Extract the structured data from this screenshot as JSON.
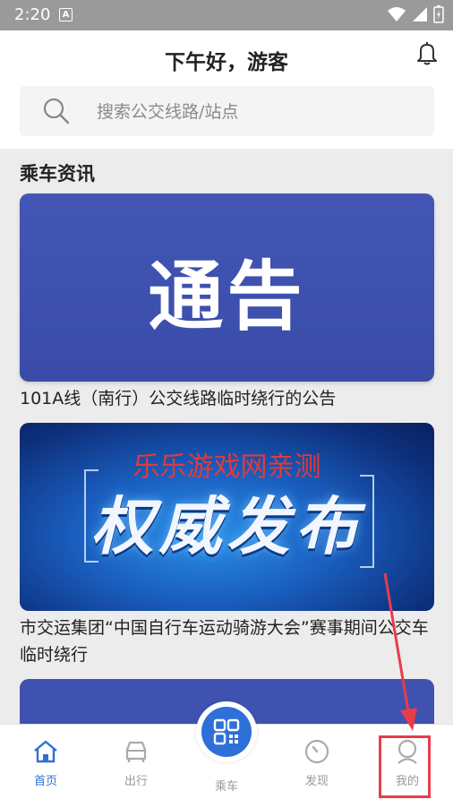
{
  "status_bar": {
    "time": "2:20",
    "badge": "A"
  },
  "header": {
    "greeting": "下午好，游客"
  },
  "search": {
    "placeholder": "搜索公交线路/站点"
  },
  "section": {
    "title": "乘车资讯"
  },
  "news": [
    {
      "image_text": "通告",
      "title": "101A线（南行）公交线路临时绕行的公告"
    },
    {
      "image_overlay": "乐乐游戏网亲测",
      "image_text": "权威发布",
      "title": "市交运集团“中国自行车运动骑游大会”赛事期间公交车临时绕行"
    }
  ],
  "tabs": [
    {
      "label": "首页",
      "icon": "home-icon",
      "active": true
    },
    {
      "label": "出行",
      "icon": "car-icon",
      "active": false
    },
    {
      "label": "乘车",
      "icon": "qr-code-icon",
      "active": false
    },
    {
      "label": "发现",
      "icon": "compass-icon",
      "active": false
    },
    {
      "label": "我的",
      "icon": "user-icon",
      "active": false
    }
  ],
  "colors": {
    "accent": "#2f6fd8",
    "highlight": "#e83c4b",
    "card_blue": "#3f52b0"
  }
}
